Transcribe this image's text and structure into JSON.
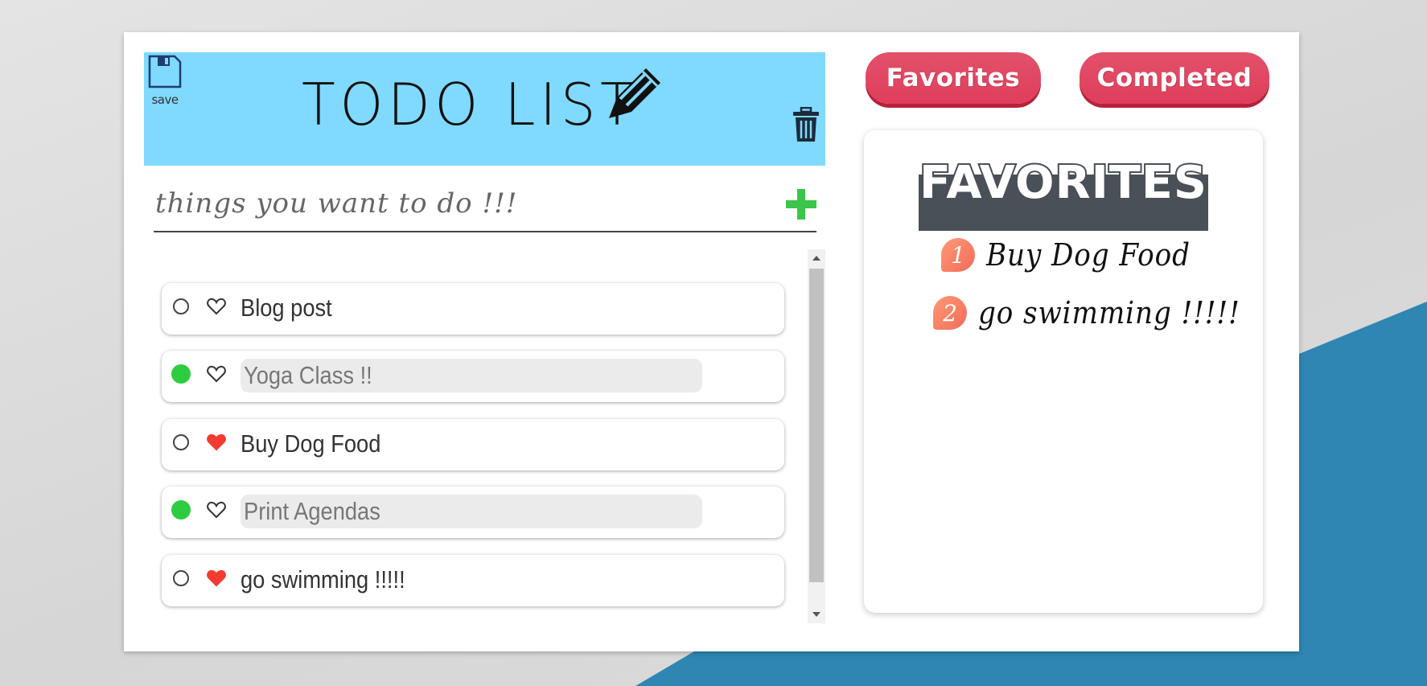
{
  "header": {
    "save_label": "save",
    "title": "TODO LIST"
  },
  "input": {
    "placeholder": "things you want to do !!!"
  },
  "todos": [
    {
      "text": "Blog post",
      "completed": false,
      "favorite": false
    },
    {
      "text": "Yoga Class !!",
      "completed": true,
      "favorite": false
    },
    {
      "text": "Buy Dog Food",
      "completed": false,
      "favorite": true
    },
    {
      "text": "Print Agendas",
      "completed": true,
      "favorite": false
    },
    {
      "text": "go swimming !!!!!",
      "completed": false,
      "favorite": true
    }
  ],
  "tabs": {
    "favorites": "Favorites",
    "completed": "Completed"
  },
  "favorites_panel": {
    "title": "FAVORITES",
    "items": [
      {
        "num": "1",
        "text": "Buy Dog Food"
      },
      {
        "num": "2",
        "text": "go swimming !!!!!"
      }
    ]
  },
  "colors": {
    "header_bg": "#80d9fe",
    "tab_bg": "#e03e5b",
    "check_done": "#2ecc40",
    "heart_fav": "#f43b2f",
    "add_icon": "#3cc54b",
    "fav_title_bg": "#4a5058",
    "background_accent": "#2f86b3"
  },
  "icons": {
    "save": "floppy-disk-icon",
    "title": "pencil-icon",
    "delete": "trash-icon",
    "add": "plus-icon",
    "check": "circle-icon",
    "favorite": "heart-icon"
  }
}
